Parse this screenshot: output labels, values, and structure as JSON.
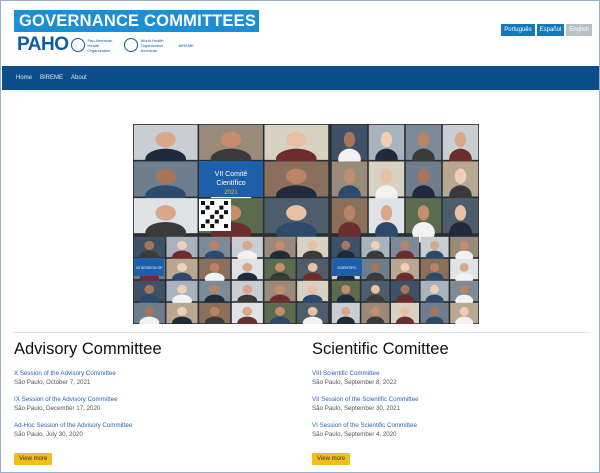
{
  "header": {
    "title": "GOVERNANCE COMMITTEES",
    "logo_text": "PAHO",
    "logo_org_line1": "Pan American",
    "logo_org_line2": "Health",
    "logo_org_line3": "Organization",
    "logo_who_line1": "World Health",
    "logo_who_line2": "Organization",
    "logo_who_line3": "Americas",
    "logo_office_line1": "BIREME",
    "logo_office_line2": "",
    "languages": [
      {
        "label": "Português",
        "active": false
      },
      {
        "label": "Español",
        "active": false
      },
      {
        "label": "English",
        "active": true
      }
    ]
  },
  "nav": {
    "items": [
      "Home",
      "BIREME",
      "About"
    ]
  },
  "photo": {
    "banner_line1": "VII Comitê",
    "banner_line2": "Científico",
    "banner_line3": "2021",
    "side_label1": "VII SESSION OF",
    "side_label2": "SCIENTIFIC"
  },
  "colors": {
    "brand": "#1a8fd6",
    "navbar": "#0b4e8a",
    "link": "#2a62b6",
    "button": "#f2be1a"
  },
  "advisory": {
    "heading": "Advisory Committee",
    "entries": [
      {
        "title": "X Session of the Advisory Committee",
        "sub": "São Paulo, October 7, 2021"
      },
      {
        "title": "IX Session of the Advisory Committee",
        "sub": "São Paulo, December 17, 2020"
      },
      {
        "title": "Ad-Hoc Session of the Advisory Committee",
        "sub": "São Paulo, July 30, 2020"
      }
    ],
    "button_label": "View more"
  },
  "scientific": {
    "heading": "Scientific Comittee",
    "entries": [
      {
        "title": "VIII Scientific Committee",
        "sub": "São Paulo, September 8, 2022"
      },
      {
        "title": "VII Session of the Scientific Committee",
        "sub": "São Paulo, September 30, 2021"
      },
      {
        "title": "VI Session of the Scientific Committee",
        "sub": "São Paulo, September 4, 2020"
      }
    ],
    "button_label": "View more"
  }
}
